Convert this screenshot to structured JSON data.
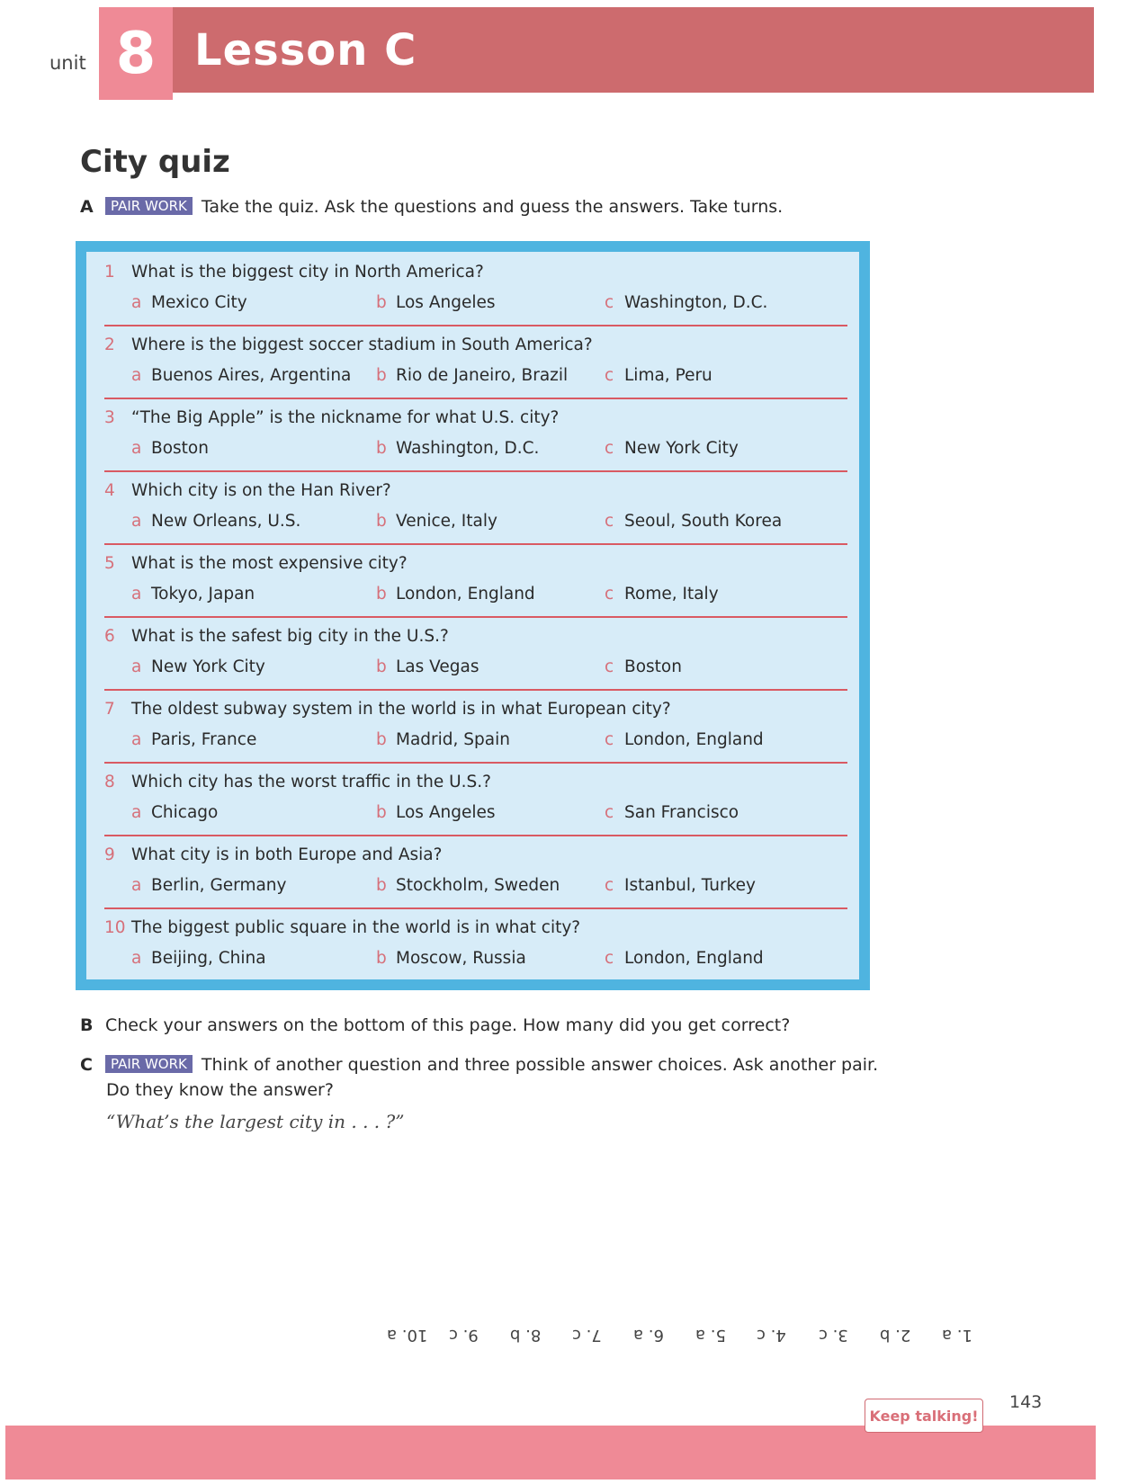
{
  "header": {
    "unit_label": "unit",
    "unit_number": "8",
    "lesson_title": "Lesson C"
  },
  "section_title": "City quiz",
  "instructions": {
    "a": {
      "letter": "A",
      "badge": "PAIR WORK",
      "text": "Take the quiz. Ask the questions and guess the answers. Take turns."
    },
    "b": {
      "letter": "B",
      "text": "Check your answers on the bottom of this page. How many did you get correct?"
    },
    "c": {
      "letter": "C",
      "badge": "PAIR WORK",
      "text": "Think of another question and three possible answer choices. Ask another pair.",
      "text2": "Do they know the answer?"
    }
  },
  "quiz": [
    {
      "num": "1",
      "question": "What is the biggest city in North America?",
      "a": "Mexico City",
      "b": "Los Angeles",
      "c": "Washington, D.C."
    },
    {
      "num": "2",
      "question": "Where is the biggest soccer stadium in South America?",
      "a": "Buenos Aires, Argentina",
      "b": "Rio de Janeiro, Brazil",
      "c": "Lima, Peru"
    },
    {
      "num": "3",
      "question": "“The Big Apple” is the nickname for what U.S. city?",
      "a": "Boston",
      "b": "Washington, D.C.",
      "c": "New York City"
    },
    {
      "num": "4",
      "question": "Which city is on the Han River?",
      "a": "New Orleans, U.S.",
      "b": "Venice, Italy",
      "c": "Seoul, South Korea"
    },
    {
      "num": "5",
      "question": "What is the most expensive city?",
      "a": "Tokyo, Japan",
      "b": "London, England",
      "c": "Rome, Italy"
    },
    {
      "num": "6",
      "question": "What is the safest big city in the U.S.?",
      "a": "New York City",
      "b": "Las Vegas",
      "c": "Boston"
    },
    {
      "num": "7",
      "question": "The oldest subway system in the world is in what European city?",
      "a": "Paris, France",
      "b": "Madrid, Spain",
      "c": "London, England"
    },
    {
      "num": "8",
      "question": "Which city has the worst traffic in the U.S.?",
      "a": "Chicago",
      "b": "Los Angeles",
      "c": "San Francisco"
    },
    {
      "num": "9",
      "question": "What city is in both Europe and Asia?",
      "a": "Berlin, Germany",
      "b": "Stockholm, Sweden",
      "c": "Istanbul, Turkey"
    },
    {
      "num": "10",
      "question": "The biggest public square in the world is in what city?",
      "a": "Beijing, China",
      "b": "Moscow, Russia",
      "c": "London, England"
    }
  ],
  "option_letters": {
    "a": "a",
    "b": "b",
    "c": "c"
  },
  "example": "“What’s the largest city in . . . ?”",
  "answer_key": [
    "1. a",
    "2. b",
    "3. c",
    "4. c",
    "5. a",
    "6. a",
    "7. c",
    "8. b",
    "9. c",
    "10. a"
  ],
  "keep_talking": "Keep talking!",
  "page_number": "143"
}
